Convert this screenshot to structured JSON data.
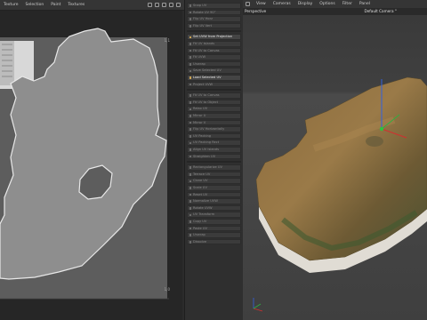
{
  "uv_editor": {
    "menu": [
      "Texture",
      "Selection",
      "Paint",
      "Textures"
    ],
    "coords": {
      "top_right": "1,1",
      "bottom_right": "1,0"
    }
  },
  "uv_commands": {
    "items": [
      "Snap UV",
      "Rotate UV 90°",
      "Flip UV Horz",
      "Flip UV Vert",
      "Set UVW from Projection",
      "Fit UV Islands",
      "Fit UV to Canvas",
      "Fit UVW",
      "Unwrap",
      "Save Selected UV",
      "Load Selected UV",
      "Project UVW",
      "Fit UV to Canvas",
      "Fit UV to Object",
      "Relax UV",
      "Mirror U",
      "Mirror V",
      "Flip UV Horizontally",
      "UV Packing",
      "UV Packing Rect",
      "Align UV Islands",
      "Straighten UV",
      "Rectangularize UV",
      "Terrace UV",
      "Clone UV",
      "Scale UV",
      "Reset UV",
      "Normalize UVW",
      "Rotate UVW",
      "UV Transform",
      "Copy UV",
      "Paste UV",
      "Unwrap",
      "Dissolve"
    ],
    "active": [
      4,
      10
    ]
  },
  "viewport": {
    "menu": [
      "View",
      "Cameras",
      "Display",
      "Options",
      "Filter",
      "Panel"
    ],
    "perspective_label": "Perspective",
    "camera_label": "Default Camera °"
  },
  "colors": {
    "uv_fill": "#8e8e8e",
    "uv_edge": "#e8e8e8",
    "terrain_arid": "#8a6a3a",
    "terrain_green": "#4a5a32",
    "axis_x": "#d03030",
    "axis_y": "#30b040",
    "axis_z": "#3060e0"
  }
}
